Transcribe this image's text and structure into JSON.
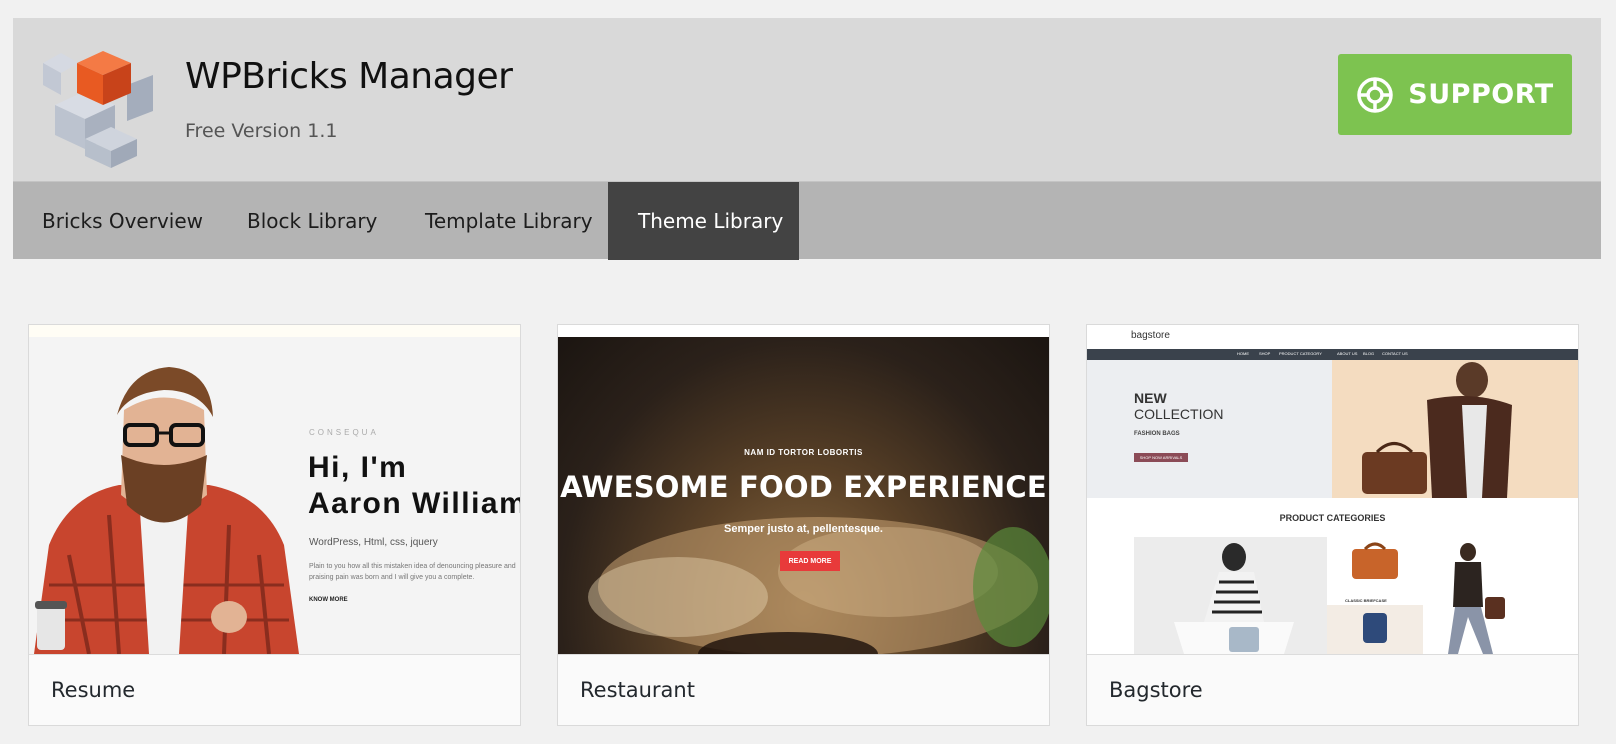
{
  "header": {
    "title": "WPBricks Manager",
    "version": "Free Version 1.1",
    "support_label": "SUPPORT"
  },
  "nav": {
    "tabs": [
      {
        "label": "Bricks Overview",
        "active": false
      },
      {
        "label": "Block Library",
        "active": false
      },
      {
        "label": "Template Library",
        "active": false
      },
      {
        "label": "Theme Library",
        "active": true
      }
    ]
  },
  "themes": [
    {
      "name": "Resume",
      "preview": {
        "eyebrow": "CONSEQUA",
        "heading_line1": "Hi, I'm",
        "heading_line2": "Aaron William",
        "skills": "WordPress, Html, css, jquery",
        "desc": "Plain to you how all this mistaken idea of denouncing pleasure and praising pain was born and I will give you a complete.",
        "cta": "KNOW MORE"
      }
    },
    {
      "name": "Restaurant",
      "preview": {
        "eyebrow": "NAM ID TORTOR LOBORTIS",
        "title": "AWESOME FOOD EXPERIENCE",
        "subtitle": "Semper justo at, pellentesque.",
        "cta": "READ MORE"
      }
    },
    {
      "name": "Bagstore",
      "preview": {
        "logo": "bagstore",
        "menu": [
          "HOME",
          "SHOP",
          "PRODUCT CATEGORY",
          "ABOUT US",
          "BLOG",
          "CONTACT US"
        ],
        "hero_line1": "NEW",
        "hero_line2": "COLLECTION",
        "hero_sub": "FASHION BAGS",
        "hero_cta": "SHOP NOW ARRIVALS",
        "section_title": "PRODUCT CATEGORIES",
        "category_label": "CLASSIC BRIEFCASE"
      }
    }
  ],
  "colors": {
    "support": "#7dc350",
    "active_tab": "#434343",
    "nav": "#b4b4b4",
    "header": "#d9d9d9",
    "logo_accent": "#f05a28"
  },
  "icons": {
    "support": "lifebuoy-icon",
    "logo": "cubes-logo"
  }
}
